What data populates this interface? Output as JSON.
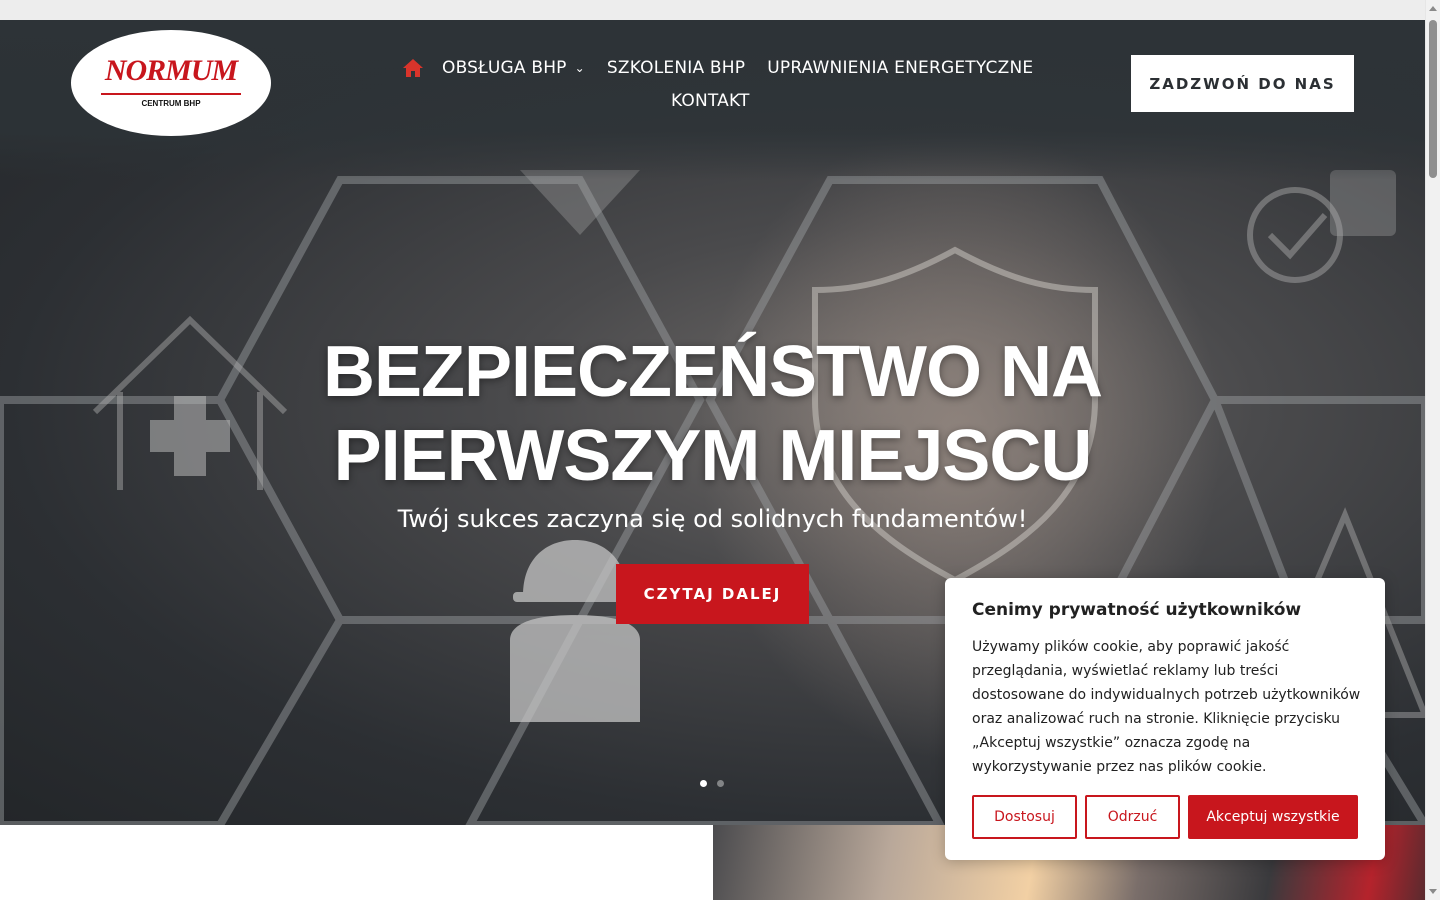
{
  "brand": {
    "logo_text": "NORMUM",
    "logo_sub": "CENTRUM BHP",
    "accent_color": "#c8161d"
  },
  "nav": {
    "home_icon": "home-icon",
    "items": [
      {
        "label": "OBSŁUGA BHP",
        "has_dropdown": true
      },
      {
        "label": "SZKOLENIA BHP"
      },
      {
        "label": "UPRAWNIENIA ENERGETYCZNE"
      },
      {
        "label": "KONTAKT"
      }
    ]
  },
  "header": {
    "call_button": "ZADZWOŃ DO NAS"
  },
  "hero": {
    "title_line1": "BEZPIECZEŃSTWO NA",
    "title_line2": "PIERWSZYM MIEJSCU",
    "subtitle": "Twój sukces zaczyna się od solidnych fundamentów!",
    "cta": "CZYTAJ DALEJ",
    "slides_total": 2,
    "active_slide": 1
  },
  "cookie_banner": {
    "title": "Cenimy prywatność użytkowników",
    "text": "Używamy plików cookie, aby poprawić jakość przeglądania, wyświetlać reklamy lub treści dostosowane do indywidualnych potrzeb użytkowników oraz analizować ruch na stronie. Kliknięcie przycisku „Akceptuj wszystkie” oznacza zgodę na wykorzystywanie przez nas plików cookie.",
    "customize": "Dostosuj",
    "reject": "Odrzuć",
    "accept": "Akceptuj wszystkie"
  }
}
